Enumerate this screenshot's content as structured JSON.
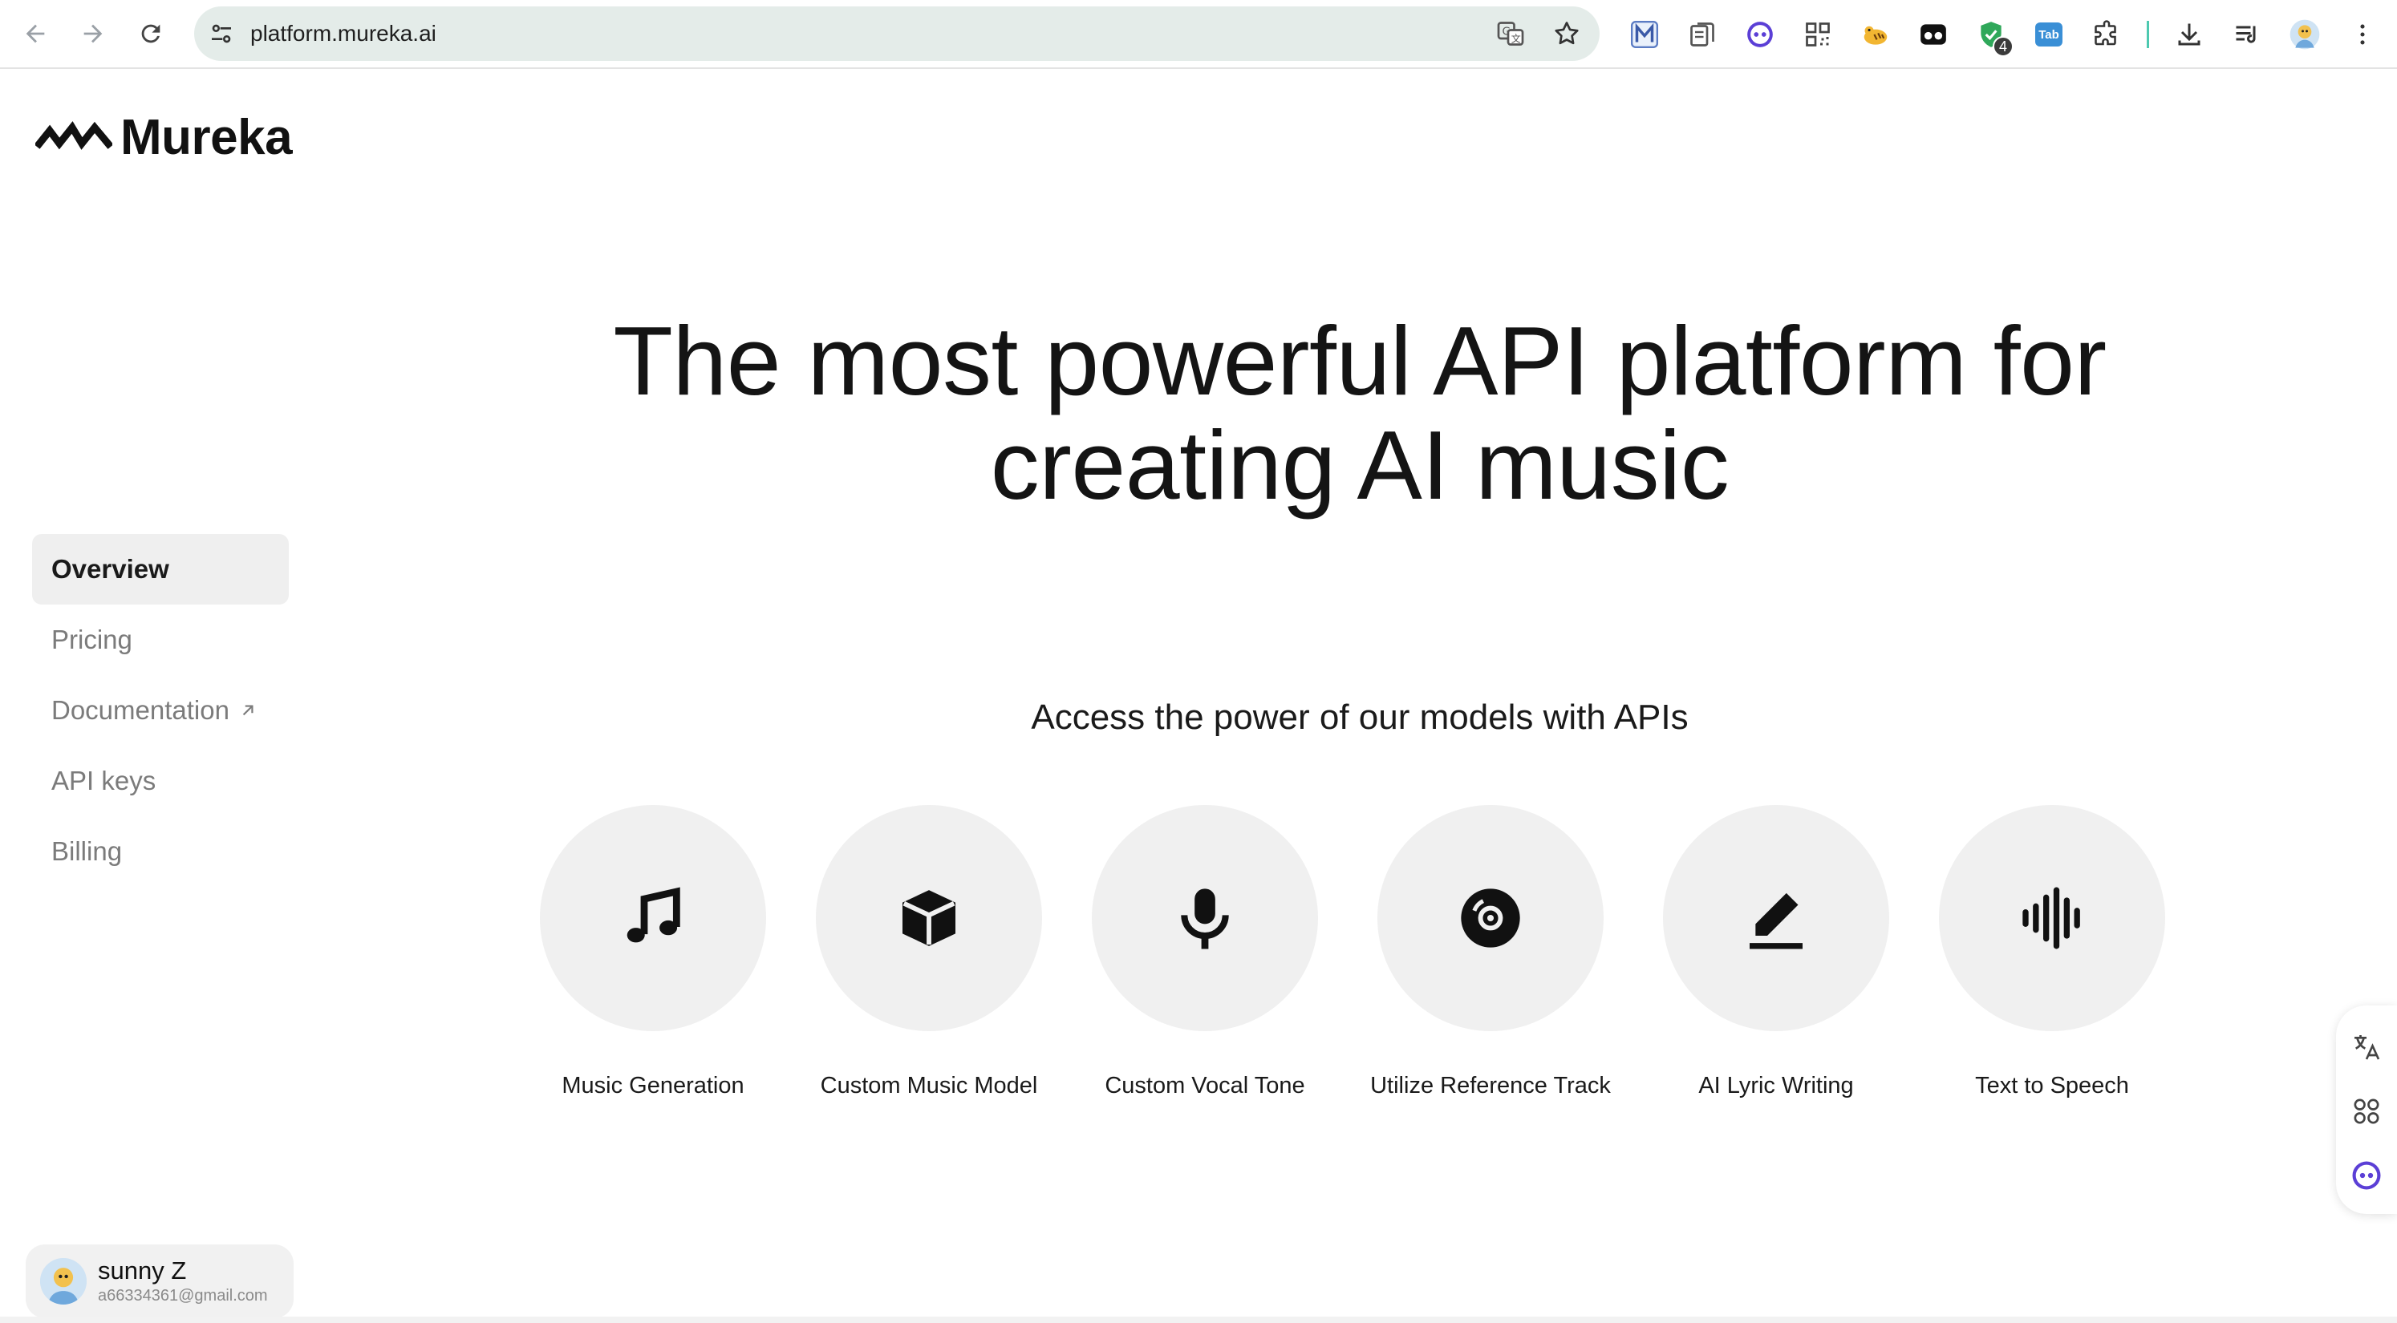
{
  "browser": {
    "url": "platform.mureka.ai",
    "extension_badge_count": "4",
    "extension_tab_label": "Tab"
  },
  "brand": {
    "name": "Mureka"
  },
  "sidebar": {
    "items": [
      {
        "label": "Overview",
        "active": true
      },
      {
        "label": "Pricing",
        "active": false
      },
      {
        "label": "Documentation",
        "active": false,
        "external": true
      },
      {
        "label": "API keys",
        "active": false
      },
      {
        "label": "Billing",
        "active": false
      }
    ]
  },
  "user": {
    "name": "sunny Z",
    "email": "a66334361@gmail.com"
  },
  "main": {
    "headline_line1": "The most powerful API platform for",
    "headline_line2": "creating AI music",
    "subheading": "Access the power of our models with APIs",
    "features": [
      {
        "label": "Music Generation",
        "icon": "music-note-icon"
      },
      {
        "label": "Custom Music Model",
        "icon": "cube-icon"
      },
      {
        "label": "Custom Vocal Tone",
        "icon": "microphone-icon"
      },
      {
        "label": "Utilize Reference Track",
        "icon": "vinyl-disc-icon"
      },
      {
        "label": "AI Lyric Writing",
        "icon": "pencil-icon"
      },
      {
        "label": "Text to Speech",
        "icon": "sound-wave-icon"
      }
    ]
  },
  "colors": {
    "accent_purple": "#5b3fd6",
    "omnibox_bg": "#e4ece9",
    "active_nav_bg": "#efefef",
    "feature_circle_bg": "#f0f0f0"
  }
}
